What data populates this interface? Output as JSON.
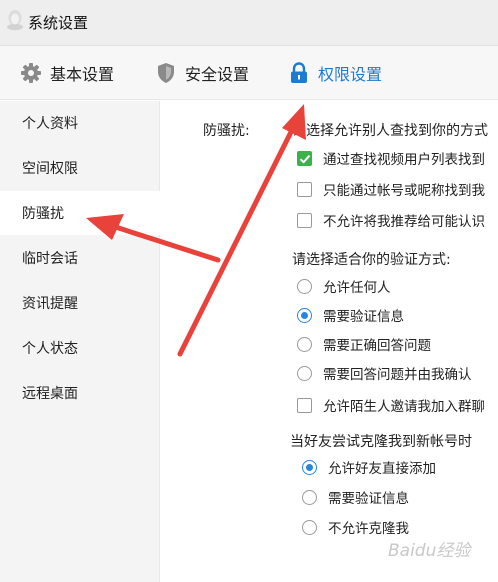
{
  "window": {
    "title": "系统设置"
  },
  "tabs": [
    {
      "label": "基本设置",
      "icon": "gear-icon"
    },
    {
      "label": "安全设置",
      "icon": "shield-icon"
    },
    {
      "label": "权限设置",
      "icon": "lock-icon",
      "active": true
    }
  ],
  "sidebar": {
    "items": [
      {
        "label": "个人资料"
      },
      {
        "label": "空间权限"
      },
      {
        "label": "防骚扰",
        "active": true
      },
      {
        "label": "临时会话"
      },
      {
        "label": "资讯提醒"
      },
      {
        "label": "个人状态"
      },
      {
        "label": "远程桌面"
      }
    ]
  },
  "anti_harass": {
    "label": "防骚扰:",
    "find_heading": "请选择允许别人查找到你的方式",
    "find_options": [
      {
        "label": "通过查找视频用户列表找到",
        "checked": true
      },
      {
        "label": "只能通过帐号或昵称找到我",
        "checked": false
      },
      {
        "label": "不允许将我推荐给可能认识",
        "checked": false
      }
    ],
    "verify_heading": "请选择适合你的验证方式:",
    "verify_options": [
      {
        "label": "允许任何人",
        "selected": false
      },
      {
        "label": "需要验证信息",
        "selected": true
      },
      {
        "label": "需要正确回答问题",
        "selected": false
      },
      {
        "label": "需要回答问题并由我确认",
        "selected": false
      }
    ],
    "group_invite": {
      "label": "允许陌生人邀请我加入群聊",
      "checked": false
    },
    "clone_heading": "当好友尝试克隆我到新帐号时",
    "clone_options": [
      {
        "label": "允许好友直接添加",
        "selected": true
      },
      {
        "label": "需要验证信息",
        "selected": false
      },
      {
        "label": "不允许克隆我",
        "selected": false
      }
    ]
  },
  "watermark": "Baidu经验",
  "colors": {
    "accent": "#1e7bd0",
    "check_green": "#3cb04a",
    "arrow_red": "#e8433b"
  }
}
